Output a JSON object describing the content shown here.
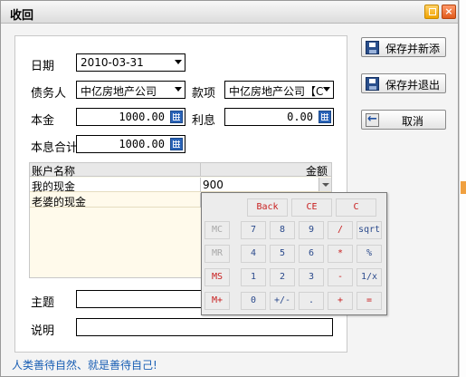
{
  "window": {
    "title": "收回"
  },
  "form": {
    "date_label": "日期",
    "date_value": "2010-03-31",
    "debtor_label": "债务人",
    "debtor_value": "中亿房地产公司",
    "item_label": "款项",
    "item_value": "中亿房地产公司【C",
    "principal_label": "本金",
    "principal_value": "1000.00",
    "interest_label": "利息",
    "interest_value": "0.00",
    "total_label": "本息合计",
    "total_value": "1000.00",
    "subject_label": "主题",
    "subject_value": "",
    "note_label": "说明",
    "note_value": ""
  },
  "grid": {
    "col_account": "账户名称",
    "col_amount": "金额",
    "rows": [
      {
        "name": "我的现金",
        "amount": "900"
      },
      {
        "name": "老婆的现金",
        "amount": ""
      }
    ]
  },
  "buttons": {
    "save_new": "保存并新添",
    "save_exit": "保存并退出",
    "cancel": "取消"
  },
  "footer": {
    "text": "人类善待自然、就是善待自己!"
  },
  "calculator": {
    "keys_row0": [
      "Back",
      "CE",
      "C"
    ],
    "keys_row1": [
      "MC",
      "7",
      "8",
      "9",
      "/",
      "sqrt"
    ],
    "keys_row2": [
      "MR",
      "4",
      "5",
      "6",
      "*",
      "%"
    ],
    "keys_row3": [
      "MS",
      "1",
      "2",
      "3",
      "-",
      "1/x"
    ],
    "keys_row4": [
      "M+",
      "0",
      "+/-",
      ".",
      "+",
      "="
    ]
  },
  "colors": {
    "link_blue": "#1a5fb4",
    "calc_red": "#c81e1e",
    "grid_bg": "#fffaeb"
  }
}
